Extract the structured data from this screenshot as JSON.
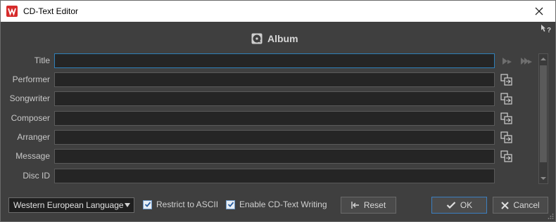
{
  "window": {
    "title": "CD-Text Editor"
  },
  "section": {
    "title": "Album",
    "icon": "disc-icon"
  },
  "fields": [
    {
      "label": "Title",
      "value": "",
      "has_copy": false
    },
    {
      "label": "Performer",
      "value": "",
      "has_copy": true
    },
    {
      "label": "Songwriter",
      "value": "",
      "has_copy": true
    },
    {
      "label": "Composer",
      "value": "",
      "has_copy": true
    },
    {
      "label": "Arranger",
      "value": "",
      "has_copy": true
    },
    {
      "label": "Message",
      "value": "",
      "has_copy": true
    },
    {
      "label": "Disc ID",
      "value": "",
      "has_copy": false
    }
  ],
  "footer": {
    "language": "Western European Language",
    "restrict_ascii_label": "Restrict to ASCII",
    "restrict_ascii_checked": true,
    "enable_writing_label": "Enable CD-Text Writing",
    "enable_writing_checked": true,
    "reset_label": "Reset",
    "ok_label": "OK",
    "cancel_label": "Cancel"
  },
  "colors": {
    "background": "#3f3f3f",
    "field": "#252525",
    "focus_border": "#2f7fb8"
  }
}
